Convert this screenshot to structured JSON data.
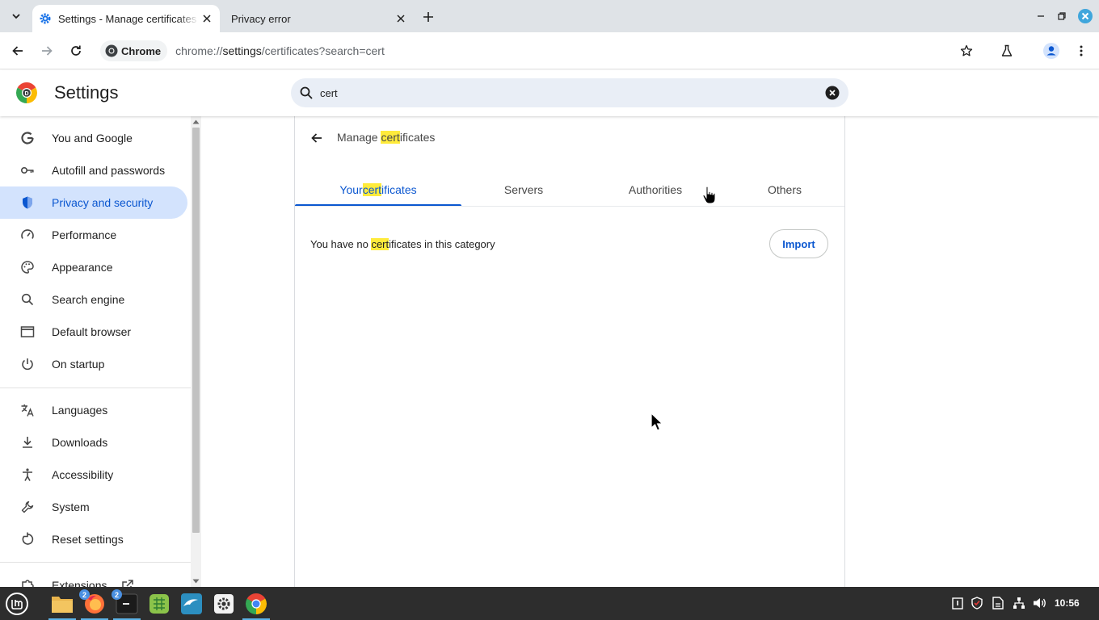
{
  "browser": {
    "tabs": [
      {
        "title": "Settings - Manage certificates",
        "active": true
      },
      {
        "title": "Privacy error",
        "active": false
      }
    ],
    "omnibox": {
      "chip_label": "Chrome",
      "url_prefix": "chrome://",
      "url_host": "settings",
      "url_path": "/certificates?search=cert"
    }
  },
  "settings": {
    "title": "Settings",
    "search_value": "cert",
    "nav": [
      {
        "label": "You and Google",
        "icon": "google-g-icon"
      },
      {
        "label": "Autofill and passwords",
        "icon": "key-icon"
      },
      {
        "label": "Privacy and security",
        "icon": "shield-icon",
        "selected": true
      },
      {
        "label": "Performance",
        "icon": "speedometer-icon"
      },
      {
        "label": "Appearance",
        "icon": "palette-icon"
      },
      {
        "label": "Search engine",
        "icon": "search-icon"
      },
      {
        "label": "Default browser",
        "icon": "browser-window-icon"
      },
      {
        "label": "On startup",
        "icon": "power-icon"
      },
      {
        "label": "Languages",
        "icon": "translate-icon"
      },
      {
        "label": "Downloads",
        "icon": "download-icon"
      },
      {
        "label": "Accessibility",
        "icon": "accessibility-icon"
      },
      {
        "label": "System",
        "icon": "wrench-icon"
      },
      {
        "label": "Reset settings",
        "icon": "reset-icon"
      },
      {
        "label": "Extensions",
        "icon": "puzzle-icon"
      }
    ]
  },
  "certificates": {
    "title_before": "Manage ",
    "title_highlight": "cert",
    "title_after": "ificates",
    "tabs": {
      "yours_before": "Your ",
      "yours_highlight": "cert",
      "yours_after": "ificates",
      "servers": "Servers",
      "authorities": "Authorities",
      "others": "Others"
    },
    "empty_before": "You have no ",
    "empty_highlight": "cert",
    "empty_after": "ificates in this category",
    "import_label": "Import"
  },
  "taskbar": {
    "badges": {
      "firefox": "2",
      "terminal": "2"
    },
    "clock": "10:56"
  },
  "colors": {
    "accent": "#0b57d0",
    "selected_nav_bg": "#d3e3fd",
    "highlight": "#ffeb3b",
    "tab_strip": "#dfe3e7",
    "taskbar": "#2d2d2d"
  }
}
